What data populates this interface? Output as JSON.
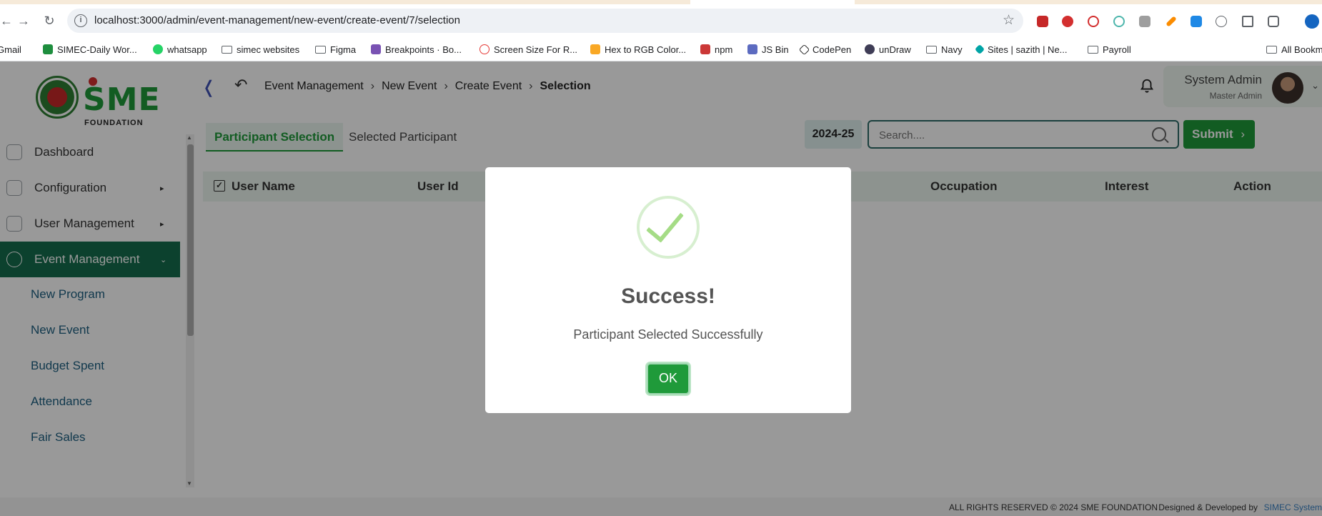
{
  "browser": {
    "url": "localhost:3000/admin/event-management/new-event/create-event/7/selection",
    "bookmarks": [
      {
        "label": "Gmail",
        "icon": "gmail-icon"
      },
      {
        "label": "SIMEC-Daily Wor...",
        "icon": "sheet-icon"
      },
      {
        "label": "whatsapp",
        "icon": "whatsapp-icon"
      },
      {
        "label": "simec websites",
        "icon": "folder-icon"
      },
      {
        "label": "Figma",
        "icon": "folder-icon"
      },
      {
        "label": "Breakpoints · Bo...",
        "icon": "bootstrap-icon"
      },
      {
        "label": "Screen Size For R...",
        "icon": "globe-icon"
      },
      {
        "label": "Hex to RGB Color...",
        "icon": "r-icon"
      },
      {
        "label": "npm",
        "icon": "npm-icon"
      },
      {
        "label": "JS Bin",
        "icon": "jsbin-icon"
      },
      {
        "label": "CodePen",
        "icon": "codepen-icon"
      },
      {
        "label": "unDraw",
        "icon": "undraw-icon"
      },
      {
        "label": "Navy",
        "icon": "folder-icon"
      },
      {
        "label": "Sites | sazith | Ne...",
        "icon": "sites-icon"
      },
      {
        "label": "Payroll",
        "icon": "folder-icon"
      },
      {
        "label": "All Bookm",
        "icon": "folder-icon"
      }
    ]
  },
  "brand": {
    "logo_text": "SME",
    "logo_sub": "FOUNDATION"
  },
  "header": {
    "breadcrumb": [
      "Event Management",
      "New Event",
      "Create Event",
      "Selection"
    ],
    "user_name": "System Admin",
    "user_role": "Master Admin"
  },
  "sidebar": {
    "items": [
      {
        "label": "Dashboard",
        "has_arrow": false
      },
      {
        "label": "Configuration",
        "has_arrow": true
      },
      {
        "label": "User Management",
        "has_arrow": true
      },
      {
        "label": "Event Management",
        "has_arrow": true,
        "active": true
      }
    ],
    "subitems": [
      "New Program",
      "New Event",
      "Budget Spent",
      "Attendance",
      "Fair Sales"
    ]
  },
  "main": {
    "tabs": [
      "Participant Selection",
      "Selected Participant"
    ],
    "fiscal_year": "2024-25",
    "search_placeholder": "Search....",
    "submit_label": "Submit",
    "columns": [
      "User Name",
      "User Id",
      "Occupation",
      "Interest",
      "Action"
    ]
  },
  "footer": {
    "copyright": "ALL RIGHTS RESERVED © 2024 SME FOUNDATION",
    "designed": "Designed & Developed by",
    "company": "SIMEC System"
  },
  "modal": {
    "title": "Success!",
    "message": "Participant Selected Successfully",
    "ok_label": "OK"
  },
  "colors": {
    "accent": "#1f9a3a",
    "active_nav": "#146d4e",
    "success_check": "#a5dc86"
  }
}
